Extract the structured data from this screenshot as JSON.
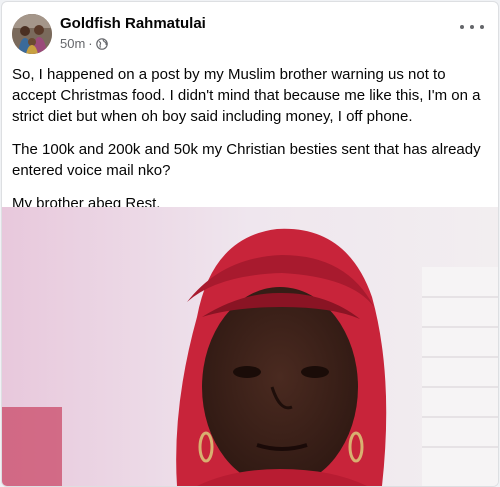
{
  "post": {
    "author": "Goldfish Rahmatulai",
    "timestamp": "50m",
    "separator": "·",
    "privacy_icon": "globe-icon",
    "more_icon": "more-options-icon",
    "paragraphs": [
      "So, I happened on a post by my Muslim brother warning us not to accept Christmas food. I didn't mind that because me like this, I'm on a strict diet but when oh boy said including money, I off phone.",
      "The 100k and 200k and 50k my Christian besties  sent  that has already entered voice mail nko?",
      "My brother abeg Rest."
    ],
    "image": "photo of a woman wearing a red headscarf"
  },
  "colors": {
    "author": "#050505",
    "meta": "#65676b",
    "headscarf": "#c8243a",
    "background": "#ffffff"
  }
}
